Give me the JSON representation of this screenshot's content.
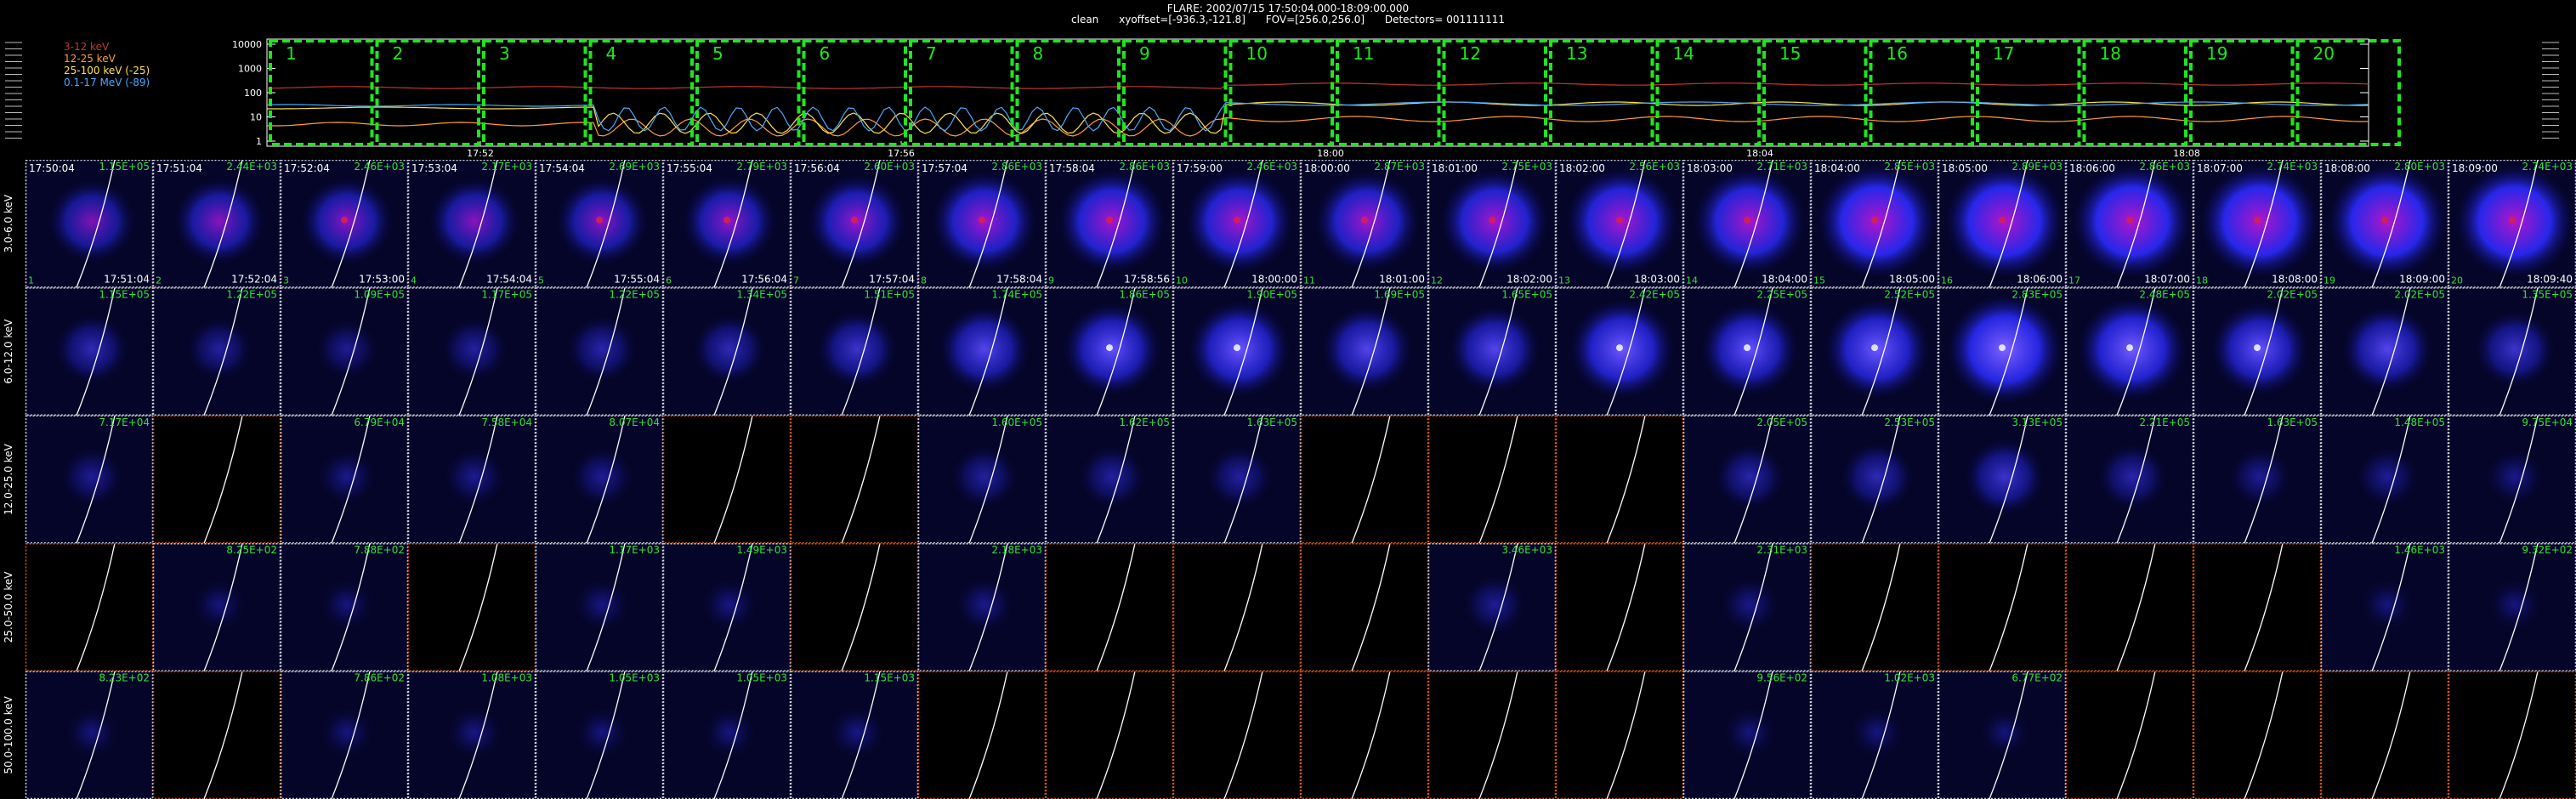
{
  "header": {
    "flare_line": "FLARE: 2002/07/15 17:50:04.000-18:09:00.000",
    "method": "clean",
    "xyoffset": "xyoffset=[-936.3,-121.8]",
    "fov": "FOV=[256.0,256.0]",
    "detectors": "Detectors= 001111111"
  },
  "lightcurve": {
    "yticks": [
      "10000",
      "1000",
      "100",
      "10",
      "1"
    ],
    "xticks": [
      "17:52",
      "17:56",
      "18:00",
      "18:04",
      "18:08"
    ],
    "legend": [
      {
        "label": "3-12 keV",
        "color": "#c0392b"
      },
      {
        "label": "12-25 keV",
        "color": "#ff9a3c"
      },
      {
        "label": "25-100 keV (-25)",
        "color": "#ffe14d"
      },
      {
        "label": "0.1-17 MeV (-89)",
        "color": "#4aa8ff"
      }
    ],
    "interval_numbers": [
      "1",
      "2",
      "3",
      "4",
      "5",
      "6",
      "7",
      "8",
      "9",
      "10",
      "11",
      "12",
      "13",
      "14",
      "15",
      "16",
      "17",
      "18",
      "19",
      "20"
    ],
    "box_color": "#1ee61e"
  },
  "bands": [
    "3.0-6.0 keV",
    "6.0-12.0 keV",
    "12.0-25.0 keV",
    "25.0-50.0 keV",
    "50.0-100.0 keV"
  ],
  "start_times": [
    "17:50:04",
    "17:51:04",
    "17:52:04",
    "17:53:04",
    "17:54:04",
    "17:55:04",
    "17:56:04",
    "17:57:04",
    "17:58:04",
    "17:59:00",
    "18:00:00",
    "18:01:00",
    "18:02:00",
    "18:03:00",
    "18:04:00",
    "18:05:00",
    "18:06:00",
    "18:07:00",
    "18:08:00",
    "18:09:00"
  ],
  "end_times": [
    "17:51:04",
    "17:52:04",
    "17:53:00",
    "17:54:04",
    "17:55:04",
    "17:56:04",
    "17:57:04",
    "17:58:04",
    "17:58:56",
    "18:00:00",
    "18:01:00",
    "18:02:00",
    "18:03:00",
    "18:04:00",
    "18:05:00",
    "18:06:00",
    "18:07:00",
    "18:08:00",
    "18:09:00",
    "18:09:40"
  ],
  "values": [
    [
      "1.15E+05",
      "2.44E+03",
      "2.46E+03",
      "2.17E+03",
      "2.69E+03",
      "2.79E+03",
      "2.60E+03",
      "2.86E+03",
      "2.86E+03",
      "2.46E+03",
      "2.87E+03",
      "2.75E+03",
      "2.56E+03",
      "2.71E+03",
      "2.85E+03",
      "2.89E+03",
      "2.86E+03",
      "2.74E+03",
      "2.80E+03",
      "2.74E+03"
    ],
    [
      "1.15E+05",
      "1.22E+05",
      "1.09E+05",
      "1.17E+05",
      "1.22E+05",
      "1.34E+05",
      "1.51E+05",
      "1.74E+05",
      "1.86E+05",
      "1.90E+05",
      "1.69E+05",
      "1.65E+05",
      "2.42E+05",
      "2.25E+05",
      "2.52E+05",
      "2.83E+05",
      "2.48E+05",
      "2.02E+05",
      "2.02E+05",
      "1.35E+05"
    ],
    [
      "7.17E+04",
      "",
      "6.79E+04",
      "7.58E+04",
      "8.07E+04",
      "",
      "",
      "1.60E+05",
      "1.62E+05",
      "1.63E+05",
      "",
      "",
      "",
      "2.05E+05",
      "2.53E+05",
      "3.13E+05",
      "2.21E+05",
      "1.63E+05",
      "1.48E+05",
      "9.75E+04"
    ],
    [
      "",
      "8.25E+02",
      "7.88E+02",
      "",
      "1.17E+03",
      "1.49E+03",
      "",
      "2.18E+03",
      "",
      "",
      "",
      "3.46E+03",
      "",
      "2.31E+03",
      "",
      "",
      "",
      "",
      "1.46E+03",
      "9.32E+02"
    ],
    [
      "8.23E+02",
      "",
      "7.86E+02",
      "1.08E+03",
      "1.05E+03",
      "1.05E+03",
      "1.15E+03",
      "",
      "",
      "",
      "",
      "",
      "",
      "9.56E+02",
      "1.02E+03",
      "6.77E+02",
      "",
      "",
      "",
      ""
    ]
  ],
  "intensity": [
    [
      0.55,
      0.6,
      0.62,
      0.6,
      0.62,
      0.65,
      0.7,
      0.8,
      0.85,
      0.85,
      0.8,
      0.85,
      0.9,
      0.9,
      1,
      1,
      1,
      1,
      1,
      1
    ],
    [
      0.35,
      0.25,
      0.2,
      0.25,
      0.3,
      0.35,
      0.45,
      0.6,
      0.7,
      0.75,
      0.6,
      0.6,
      0.8,
      0.7,
      0.8,
      0.95,
      0.85,
      0.7,
      0.6,
      0.45
    ],
    [
      0.2,
      0,
      0.15,
      0.18,
      0.2,
      0,
      0,
      0.25,
      0.25,
      0.25,
      0,
      0,
      0,
      0.3,
      0.35,
      0.45,
      0.3,
      0.2,
      0.2,
      0.15
    ],
    [
      0,
      0.1,
      0.1,
      0,
      0.12,
      0.12,
      0,
      0.15,
      0,
      0,
      0,
      0.2,
      0,
      0.15,
      0,
      0,
      0,
      0,
      0.1,
      0.1
    ],
    [
      0.1,
      0,
      0.1,
      0.12,
      0.1,
      0.1,
      0.12,
      0,
      0,
      0,
      0,
      0,
      0,
      0.1,
      0.1,
      0.08,
      0,
      0,
      0,
      0
    ]
  ],
  "colors": {
    "value_text": "#2ee62e",
    "border_ok": "#d8d8d8",
    "border_bad": "#e05a14",
    "limb": "#ffffff",
    "panel_bg": "#05052a"
  }
}
